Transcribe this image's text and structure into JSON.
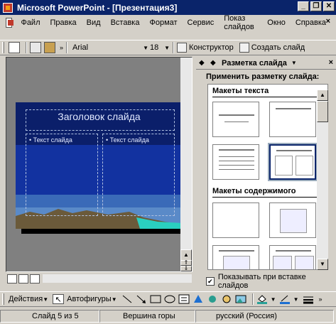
{
  "window": {
    "title": "Microsoft PowerPoint - [Презентация3]",
    "minimize": "_",
    "restore": "❐",
    "close": "✕"
  },
  "menu": {
    "items": [
      "Файл",
      "Правка",
      "Вид",
      "Вставка",
      "Формат",
      "Сервис",
      "Показ слайдов",
      "Окно",
      "Справка"
    ],
    "close": "×"
  },
  "toolbar": {
    "font_name": "Arial",
    "font_size": "18",
    "designer": "Конструктор",
    "new_slide": "Создать слайд"
  },
  "slide": {
    "title": "Заголовок слайда",
    "text_left": "• Текст слайда",
    "text_right": "• Текст слайда"
  },
  "task_pane": {
    "title": "Разметка слайда",
    "apply_label": "Применить разметку слайда:",
    "section_text": "Макеты текста",
    "section_content": "Макеты содержимого",
    "show_on_insert": "Показывать при вставке слайдов",
    "show_on_insert_checked": true
  },
  "draw": {
    "actions": "Действия",
    "autoshapes": "Автофигуры"
  },
  "status": {
    "slide": "Слайд 5 из 5",
    "design": "Вершина горы",
    "language": "русский (Россия)"
  },
  "colors": {
    "titlebar": "#0a246a",
    "slide_bg": "#0a1f66"
  }
}
